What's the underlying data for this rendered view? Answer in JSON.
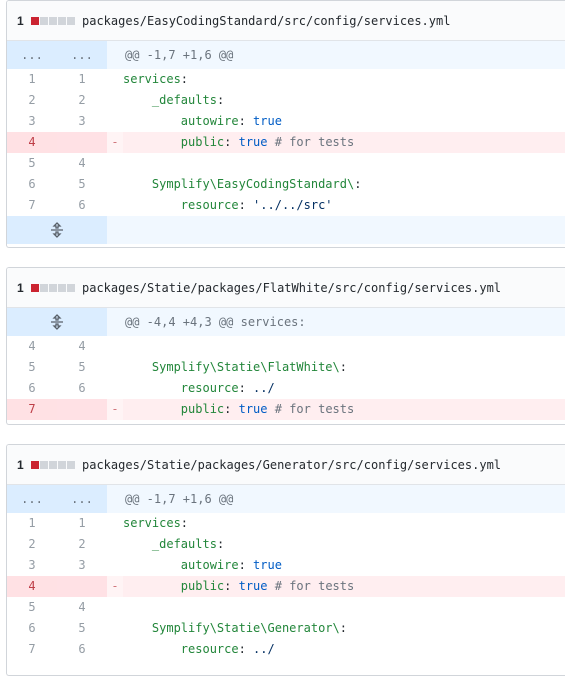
{
  "files": [
    {
      "count": "1",
      "path": "packages/EasyCodingStandard/src/config/services.yml",
      "hunk": {
        "old": "...",
        "new": "...",
        "text": "@@ -1,7 +1,6 @@"
      },
      "lines": [
        {
          "old": "1",
          "new": "1",
          "type": "ctx",
          "indent": "",
          "key": "services",
          "sep": ":",
          "val": "",
          "comment": ""
        },
        {
          "old": "2",
          "new": "2",
          "type": "ctx",
          "indent": "    ",
          "key": "_defaults",
          "sep": ":",
          "val": "",
          "comment": ""
        },
        {
          "old": "3",
          "new": "3",
          "type": "ctx",
          "indent": "        ",
          "key": "autowire",
          "sep": ": ",
          "val": "true",
          "comment": ""
        },
        {
          "old": "4",
          "new": "",
          "type": "del",
          "indent": "        ",
          "key": "public",
          "sep": ": ",
          "val": "true",
          "comment": " # for tests"
        },
        {
          "old": "5",
          "new": "4",
          "type": "ctx",
          "indent": "",
          "key": "",
          "sep": "",
          "val": "",
          "comment": ""
        },
        {
          "old": "6",
          "new": "5",
          "type": "ctx",
          "indent": "    ",
          "key": "Symplify\\EasyCodingStandard\\",
          "sep": ":",
          "val": "",
          "comment": ""
        },
        {
          "old": "7",
          "new": "6",
          "type": "ctx",
          "indent": "        ",
          "key": "resource",
          "sep": ": ",
          "str": "'../../src'",
          "val": "",
          "comment": ""
        }
      ]
    },
    {
      "count": "1",
      "path": "packages/Statie/packages/FlatWhite/src/config/services.yml",
      "hunk": {
        "text": "@@ -4,4 +4,3 @@ services:"
      },
      "lines": [
        {
          "old": "4",
          "new": "4",
          "type": "ctx",
          "indent": "",
          "key": "",
          "sep": "",
          "val": "",
          "comment": ""
        },
        {
          "old": "5",
          "new": "5",
          "type": "ctx",
          "indent": "    ",
          "key": "Symplify\\Statie\\FlatWhite\\",
          "sep": ":",
          "val": "",
          "comment": ""
        },
        {
          "old": "6",
          "new": "6",
          "type": "ctx",
          "indent": "        ",
          "key": "resource",
          "sep": ": ",
          "str": "../",
          "val": "",
          "comment": ""
        },
        {
          "old": "7",
          "new": "",
          "type": "del",
          "indent": "        ",
          "key": "public",
          "sep": ": ",
          "val": "true",
          "comment": " # for tests"
        }
      ]
    },
    {
      "count": "1",
      "path": "packages/Statie/packages/Generator/src/config/services.yml",
      "hunk": {
        "old": "...",
        "new": "...",
        "text": "@@ -1,7 +1,6 @@"
      },
      "lines": [
        {
          "old": "1",
          "new": "1",
          "type": "ctx",
          "indent": "",
          "key": "services",
          "sep": ":",
          "val": "",
          "comment": ""
        },
        {
          "old": "2",
          "new": "2",
          "type": "ctx",
          "indent": "    ",
          "key": "_defaults",
          "sep": ":",
          "val": "",
          "comment": ""
        },
        {
          "old": "3",
          "new": "3",
          "type": "ctx",
          "indent": "        ",
          "key": "autowire",
          "sep": ": ",
          "val": "true",
          "comment": ""
        },
        {
          "old": "4",
          "new": "",
          "type": "del",
          "indent": "        ",
          "key": "public",
          "sep": ": ",
          "val": "true",
          "comment": " # for tests"
        },
        {
          "old": "5",
          "new": "4",
          "type": "ctx",
          "indent": "",
          "key": "",
          "sep": "",
          "val": "",
          "comment": ""
        },
        {
          "old": "6",
          "new": "5",
          "type": "ctx",
          "indent": "    ",
          "key": "Symplify\\Statie\\Generator\\",
          "sep": ":",
          "val": "",
          "comment": ""
        },
        {
          "old": "7",
          "new": "6",
          "type": "ctx",
          "indent": "        ",
          "key": "resource",
          "sep": ": ",
          "str": "../",
          "val": "",
          "comment": ""
        }
      ]
    }
  ],
  "colors": {
    "deleted_square": "#cb2431",
    "neutral_square": "#d1d5da"
  },
  "icons": {
    "expand": "unfold-icon",
    "marker": "-"
  }
}
